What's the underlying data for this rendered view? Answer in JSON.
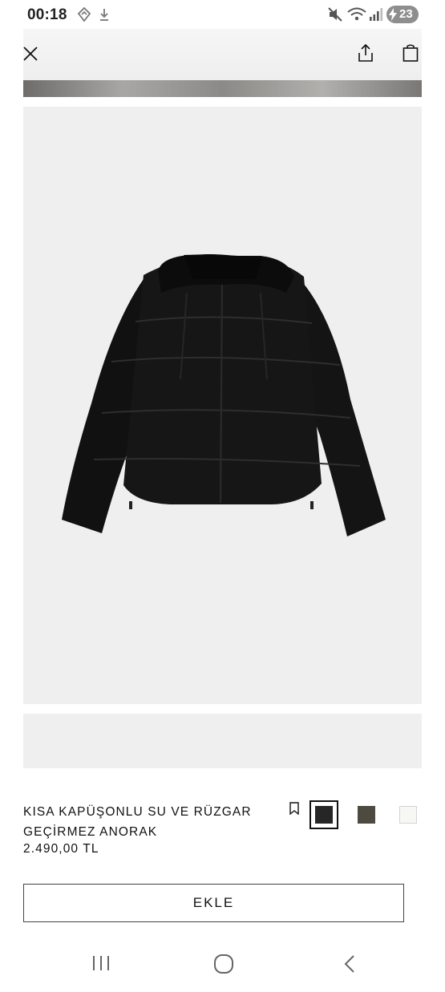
{
  "status_bar": {
    "time": "00:18",
    "battery_level": "23",
    "icons": [
      "gmaps-arrow-icon",
      "download-icon",
      "mute-icon",
      "wifi-icon",
      "signal-icon",
      "charging-icon"
    ]
  },
  "header": {
    "close_icon": "close-icon",
    "share_icon": "share-icon",
    "bag_icon": "shopping-bag-icon"
  },
  "product": {
    "name": "KISA KAPÜŞONLU SU VE RÜZGAR GEÇİRMEZ ANORAK",
    "price": "2.490,00 TL",
    "image_subject": "black hooded puffer jacket",
    "colors": [
      {
        "name": "black",
        "hex": "#262626",
        "selected": true
      },
      {
        "name": "olive",
        "hex": "#4d4b40",
        "selected": false
      },
      {
        "name": "white",
        "hex": "#f7f7f5",
        "selected": false
      }
    ]
  },
  "actions": {
    "add_label": "EKLE"
  },
  "nav": {
    "icons": [
      "recents-icon",
      "home-icon",
      "back-icon"
    ]
  },
  "colors": {
    "background": "#ffffff",
    "image_bg": "#efefef",
    "text": "#111111"
  }
}
